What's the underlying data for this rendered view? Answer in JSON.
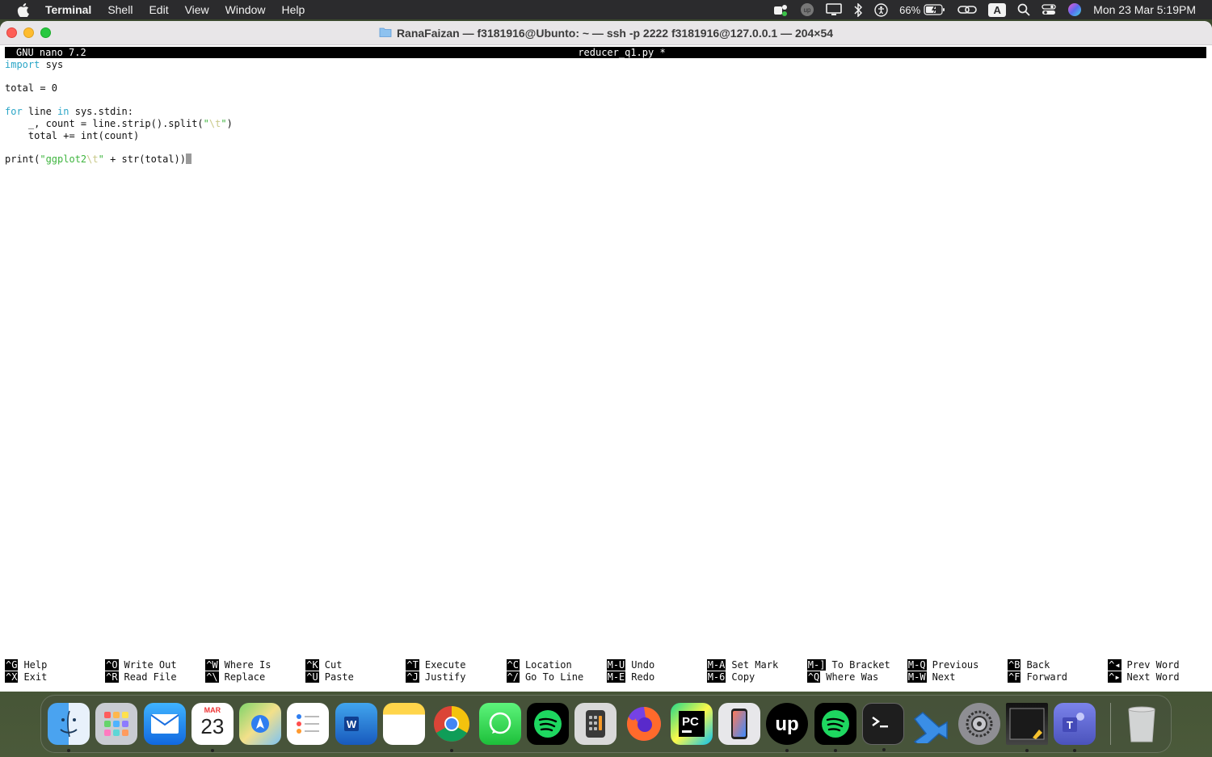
{
  "menubar": {
    "app_name": "Terminal",
    "menus": [
      "Shell",
      "Edit",
      "View",
      "Window",
      "Help"
    ],
    "battery": "66%",
    "input_source": "A",
    "clock": "Mon 23 Mar  5:19PM"
  },
  "window": {
    "title": "RanaFaizan — f3181916@Ubunto: ~ — ssh -p 2222 f3181916@127.0.0.1 — 204×54"
  },
  "nano": {
    "version": "GNU nano 7.2",
    "filename": "reducer_q1.py *",
    "code": {
      "l1_kw": "import",
      "l1_rest": " sys",
      "l3": "total = 0",
      "l5_kw1": "for",
      "l5_mid": " line ",
      "l5_kw2": "in",
      "l5_rest": " sys.stdin:",
      "l6_pre": "    _, count = line.strip().split(",
      "l6_q1": "\"",
      "l6_esc": "\\t",
      "l6_q2": "\"",
      "l6_post": ")",
      "l7": "    total += int(count)",
      "l9_pre": "print(",
      "l9_str": "\"ggplot2",
      "l9_esc": "\\t",
      "l9_q": "\"",
      "l9_post": " + str(total))"
    },
    "shortcuts_row1": [
      {
        "key": "^G",
        "label": "Help"
      },
      {
        "key": "^O",
        "label": "Write Out"
      },
      {
        "key": "^W",
        "label": "Where Is"
      },
      {
        "key": "^K",
        "label": "Cut"
      },
      {
        "key": "^T",
        "label": "Execute"
      },
      {
        "key": "^C",
        "label": "Location"
      },
      {
        "key": "M-U",
        "label": "Undo"
      },
      {
        "key": "M-A",
        "label": "Set Mark"
      },
      {
        "key": "M-]",
        "label": "To Bracket"
      },
      {
        "key": "M-Q",
        "label": "Previous"
      },
      {
        "key": "^B",
        "label": "Back"
      },
      {
        "key": "^◂",
        "label": "Prev Word"
      }
    ],
    "shortcuts_row2": [
      {
        "key": "^X",
        "label": "Exit"
      },
      {
        "key": "^R",
        "label": "Read File"
      },
      {
        "key": "^\\",
        "label": "Replace"
      },
      {
        "key": "^U",
        "label": "Paste"
      },
      {
        "key": "^J",
        "label": "Justify"
      },
      {
        "key": "^/",
        "label": "Go To Line"
      },
      {
        "key": "M-E",
        "label": "Redo"
      },
      {
        "key": "M-6",
        "label": "Copy"
      },
      {
        "key": "^Q",
        "label": "Where Was"
      },
      {
        "key": "M-W",
        "label": "Next"
      },
      {
        "key": "^F",
        "label": "Forward"
      },
      {
        "key": "^▸",
        "label": "Next Word"
      }
    ]
  },
  "dock": {
    "calendar_month": "MAR",
    "calendar_day": "23",
    "apps": [
      "finder",
      "launchpad",
      "mail",
      "calendar",
      "maps",
      "reminders",
      "word",
      "notes",
      "chrome",
      "whatsapp",
      "spotify",
      "calculator",
      "firefox",
      "pycharm",
      "iphone-mirroring",
      "upwork",
      "spotify",
      "terminal",
      "vscode",
      "system-settings",
      "preview",
      "teams",
      "trash"
    ]
  }
}
